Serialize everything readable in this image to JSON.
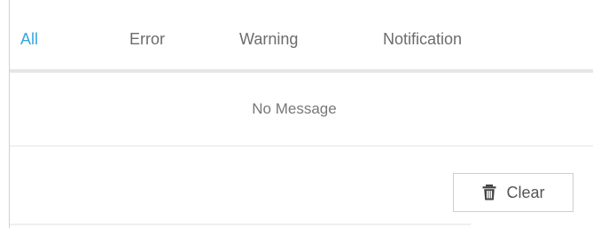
{
  "tabs": [
    {
      "label": "All"
    },
    {
      "label": "Error"
    },
    {
      "label": "Warning"
    },
    {
      "label": "Notification"
    }
  ],
  "messages": {
    "empty_text": "No Message"
  },
  "toolbar": {
    "clear_label": "Clear"
  },
  "colors": {
    "active_tab": "#35a7e0",
    "text": "#6c6c6c"
  },
  "icons": {
    "clear": "trash-icon"
  }
}
